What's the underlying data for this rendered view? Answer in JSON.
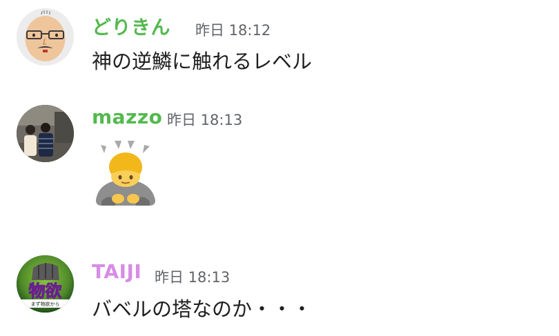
{
  "messages": [
    {
      "author": "どりきん",
      "author_color": "#54b94f",
      "time": "昨日 18:12",
      "text": "神の逆鱗に触れるレベル"
    },
    {
      "author": "mazzo",
      "author_color": "#54b94f",
      "time": "昨日 18:13",
      "emoji": "person-bowing-emoji"
    },
    {
      "author": "TAIJI",
      "author_color": "#d78ce6",
      "time": "昨日 18:13",
      "text": "バベルの塔なのか・・・",
      "avatar_text_big": "物欲",
      "avatar_text_small": "まず物欲から"
    }
  ]
}
